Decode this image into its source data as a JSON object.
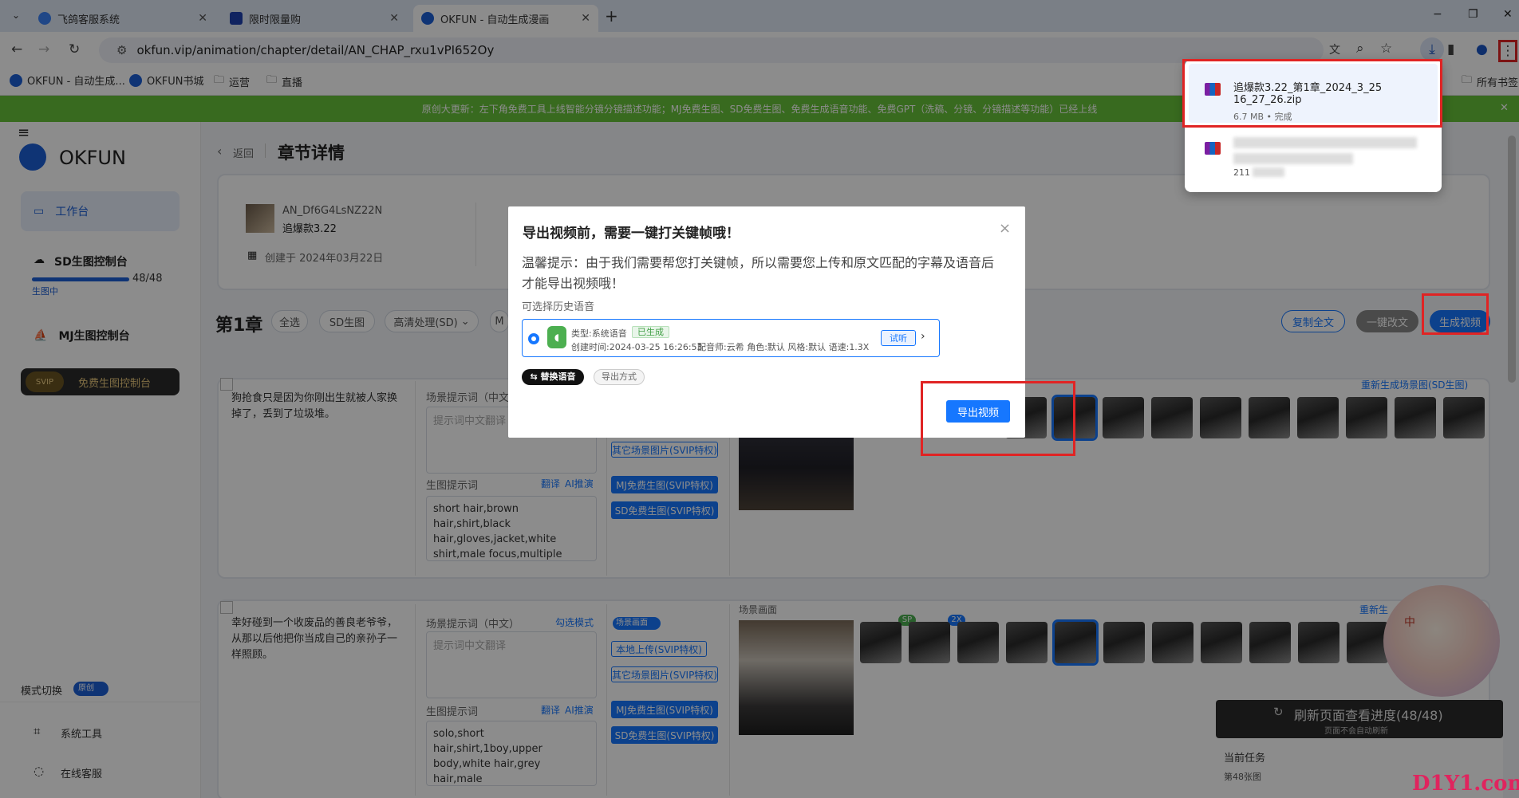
{
  "browser": {
    "tabs": [
      {
        "title": "飞鸽客服系统",
        "active": false
      },
      {
        "title": "限时限量购",
        "active": false
      },
      {
        "title": "OKFUN - 自动生成漫画",
        "active": true
      }
    ],
    "new_tab": "+",
    "url": "okfun.vip/animation/chapter/detail/AN_CHAP_rxu1vPI652Oy",
    "bookmarks": [
      "OKFUN - 自动生成...",
      "OKFUN书城",
      "运营",
      "直播"
    ],
    "bookmarks_all": "所有书签",
    "window_controls": [
      "−",
      "❐",
      "✕"
    ]
  },
  "downloads": {
    "file_name_line1": "追爆款3.22_第1章_2024_3_25",
    "file_name_line2": "16_27_26.zip",
    "file_meta": "6.7 MB • 完成",
    "second_meta": "211"
  },
  "banner": {
    "text": "原创大更新：左下角免费工具上线智能分镜分镜描述功能；MJ免费生图、SD免费生图、免费生成语音功能、免费GPT（洗稿、分镜、分镜描述等功能）已经上线"
  },
  "sidebar": {
    "menu_icon": "≡",
    "logo_text": "OKFUN",
    "items": [
      {
        "label": "工作台"
      },
      {
        "label": "SD生图控制台"
      },
      {
        "label": "MJ生图控制台"
      }
    ],
    "sd_progress": {
      "text": "48/48",
      "status": "生图中",
      "fraction": 1.0
    },
    "svip_badge": "SVIP",
    "free_console": "免费生图控制台",
    "mode_switch": "模式切换",
    "mode_value": "原创",
    "system_tools": "系统工具",
    "online_service": "在线客服"
  },
  "header": {
    "back": "返回",
    "title": "章节详情"
  },
  "info": {
    "id": "AN_Df6G4LsNZ22N",
    "name": "追爆款3.22",
    "created": "创建于 2024年03月22日"
  },
  "chapter": {
    "title": "第1章",
    "filters": [
      "全选",
      "SD生图",
      "高清处理(SD)",
      "M"
    ],
    "actions": {
      "copy_all": "复制全文",
      "rewrite": "一键改文",
      "generate_video": "生成视频"
    }
  },
  "scenes": [
    {
      "text": "狗抢食只是因为你刚出生就被人家换掉了，丢到了垃圾堆。",
      "scene_label": "场景提示词（中文）",
      "scene_placeholder": "提示词中文翻译",
      "gen_label": "生图提示词",
      "translate": "翻译",
      "ai_infer": "AI推演",
      "prompt": "short hair,brown hair,shirt,black hair,gloves,jacket,white shirt,male focus,multiple",
      "buttons": [
        "其它场景图片(SVIP特权)",
        "MJ免费生图(SVIP特权)",
        "SD免费生图(SVIP特权)"
      ],
      "regen": "重新生成场景图(SD生图)"
    },
    {
      "text": "幸好碰到一个收废品的善良老爷爷，从那以后他把你当成自己的亲孙子一样照顾。",
      "scene_label": "场景提示词（中文）",
      "select_mode": "勾选模式",
      "scene_placeholder": "提示词中文翻译",
      "gen_label": "生图提示词",
      "translate": "翻译",
      "ai_infer": "AI推演",
      "prompt": "solo,short hair,shirt,1boy,upper body,white hair,grey hair,male",
      "scene_toggle": "场景画面",
      "buttons": [
        "本地上传(SVIP特权)",
        "其它场景图片(SVIP特权)",
        "MJ免费生图(SVIP特权)",
        "SD免费生图(SVIP特权)"
      ],
      "image_label": "场景画面",
      "badges": [
        "SP",
        "2X"
      ],
      "regen": "重新生"
    }
  ],
  "progress_panel": {
    "title": "刷新页面查看进度(48/48)",
    "subtitle": "页面不会自动刷新",
    "task_label": "当前任务",
    "task_value": "第48张图"
  },
  "avatar_char": "中",
  "modal": {
    "title": "导出视频前，需要一键打关键帧哦！",
    "tip": "温馨提示：由于我们需要帮您打关键帧，所以需要您上传和原文匹配的字幕及语音后才能导出视频哦！",
    "history_label": "可选择历史语音",
    "voice": {
      "type": "类型:系统语音",
      "status": "已生成",
      "created": "创建时间:2024-03-25 16:26:53",
      "meta": "配音师:云希 角色:默认 风格:默认 语速:1.3X",
      "listen": "试听"
    },
    "replace_voice": "⇆ 替换语音",
    "export_mode": "导出方式",
    "export_button": "导出视频",
    "close": "×"
  },
  "watermark": "D1Y1.com"
}
